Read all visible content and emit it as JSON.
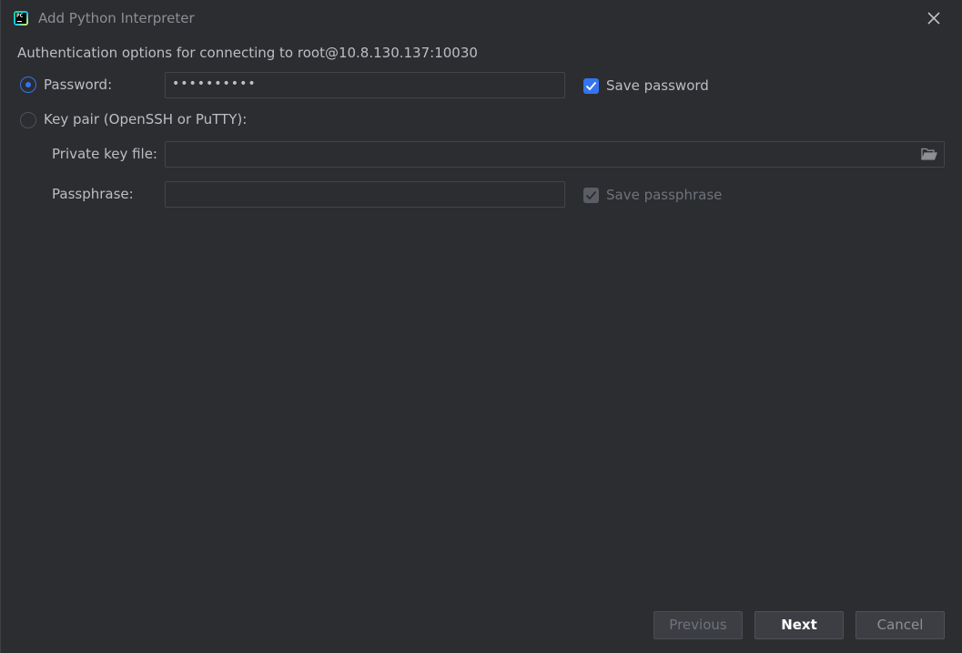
{
  "window": {
    "title": "Add Python Interpreter",
    "app_icon": "pycharm-icon",
    "app_icon_text": "PC",
    "close_icon": "close-icon"
  },
  "auth": {
    "heading": "Authentication options for connecting to root@10.8.130.137:10030",
    "password_option": {
      "label": "Password:",
      "selected": true,
      "value": "••••••••••"
    },
    "save_password": {
      "label": "Save password",
      "checked": true
    },
    "keypair_option": {
      "label": "Key pair (OpenSSH or PuTTY):",
      "selected": false
    },
    "private_key_file": {
      "label": "Private key file:",
      "value": "",
      "browse_icon": "folder-icon"
    },
    "passphrase": {
      "label": "Passphrase:",
      "value": ""
    },
    "save_passphrase": {
      "label": "Save passphrase",
      "checked": true,
      "disabled": true
    }
  },
  "footer": {
    "previous_label": "Previous",
    "next_label": "Next",
    "cancel_label": "Cancel"
  },
  "colors": {
    "background": "#2b2d30",
    "accent": "#3574f0",
    "text": "#bcbec4",
    "muted_text": "#8c8f94",
    "disabled_text": "#6f737a"
  }
}
